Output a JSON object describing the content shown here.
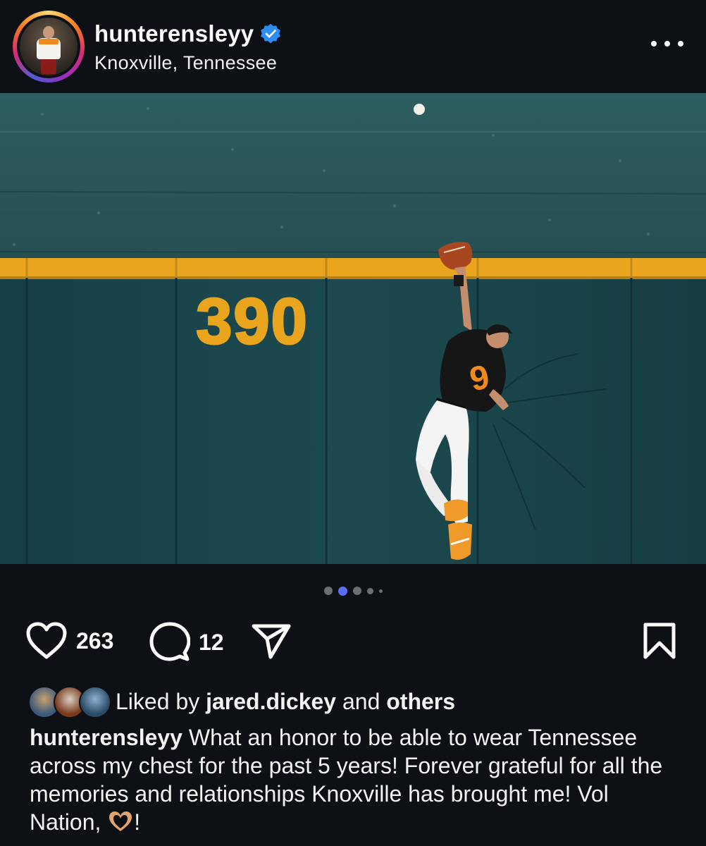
{
  "post": {
    "username": "hunterensleyy",
    "location": "Knoxville, Tennessee",
    "verified_icon": "verified-badge-icon",
    "more_icon": "more-options-icon"
  },
  "photo": {
    "wall_distance_sign": "390",
    "jersey_number": "9",
    "colors": {
      "wall": "#1f4b4f",
      "pad_top": "#e8a51d",
      "jersey": "#161616"
    }
  },
  "carousel": {
    "count": 5,
    "active_index": 1
  },
  "actions": {
    "likes_count": "263",
    "comments_count": "12",
    "like_icon": "heart-icon",
    "comment_icon": "comment-icon",
    "share_icon": "share-icon",
    "save_icon": "bookmark-icon"
  },
  "likes": {
    "prefix": "Liked by ",
    "liker": "jared.dickey",
    "middle": " and ",
    "others": "others"
  },
  "caption": {
    "username": "hunterensleyy",
    "text": " What an honor to be able to wear Tennessee across my chest for the past 5 years! Forever grateful for all the memories and relationships Knoxville has brought me! Vol Nation, ",
    "emoji_icon": "heart-hands-icon",
    "tail": "!"
  }
}
